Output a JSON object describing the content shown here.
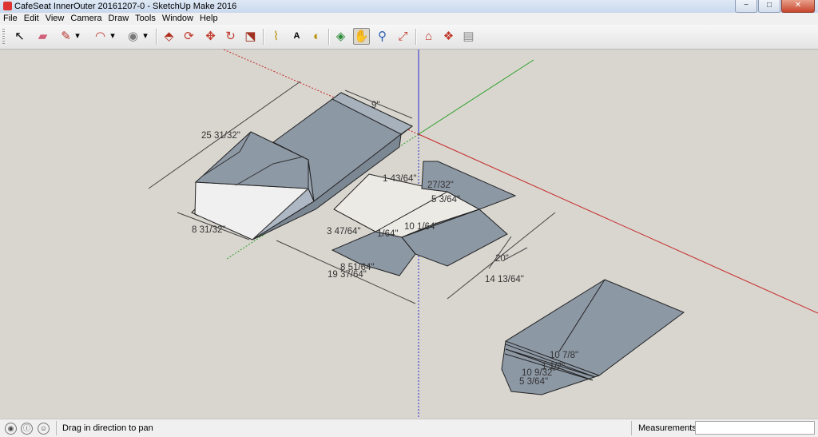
{
  "window": {
    "title": "CafeSeat InnerOuter 20161207-0 - SketchUp Make 2016",
    "controls": {
      "minimize": "−",
      "maximize": "□",
      "close": "✕"
    }
  },
  "menu": [
    "File",
    "Edit",
    "View",
    "Camera",
    "Draw",
    "Tools",
    "Window",
    "Help"
  ],
  "toolbar": {
    "tools": [
      {
        "name": "select-tool",
        "glyph": "↖",
        "active": false
      },
      {
        "name": "eraser-tool",
        "glyph": "▰",
        "active": false
      },
      {
        "name": "pencil-tool",
        "glyph": "✎",
        "active": false
      },
      {
        "name": "pencil-dropdown",
        "glyph": "▾",
        "active": false
      },
      {
        "name": "arc-tool",
        "glyph": "◠",
        "active": false
      },
      {
        "name": "arc-dropdown",
        "glyph": "▾",
        "active": false
      },
      {
        "name": "paint-bucket-tool",
        "glyph": "◉",
        "active": false
      },
      {
        "name": "paint-dropdown",
        "glyph": "▾",
        "active": false
      },
      {
        "name": "push-pull-tool",
        "glyph": "⬘",
        "active": false
      },
      {
        "name": "offset-tool",
        "glyph": "⟳",
        "active": false
      },
      {
        "name": "move-tool",
        "glyph": "✥",
        "active": false
      },
      {
        "name": "rotate-tool",
        "glyph": "↻",
        "active": false
      },
      {
        "name": "scale-tool",
        "glyph": "⬔",
        "active": false
      },
      {
        "name": "tape-measure-tool",
        "glyph": "⌇",
        "active": false
      },
      {
        "name": "text-tool",
        "glyph": "A",
        "active": false
      },
      {
        "name": "protractor-tool",
        "glyph": "◐",
        "active": false
      },
      {
        "name": "orbit-tool",
        "glyph": "◈",
        "active": false
      },
      {
        "name": "pan-tool",
        "glyph": "✋",
        "active": true
      },
      {
        "name": "zoom-tool",
        "glyph": "⚲",
        "active": false
      },
      {
        "name": "zoom-extents-tool",
        "glyph": "⤢",
        "active": false
      },
      {
        "name": "warehouse-tool",
        "glyph": "⌂",
        "active": false
      },
      {
        "name": "components-tool",
        "glyph": "❖",
        "active": false
      },
      {
        "name": "extension-tool",
        "glyph": "▤",
        "active": false
      }
    ]
  },
  "dimensions": {
    "d1": "9\"",
    "d2": "25 31/32\"",
    "d3": "8 31/32\"",
    "d4": "1 43/64\"",
    "d5": "27/32\"",
    "d6": "5 3/64\"",
    "d7": "10 1/64\"",
    "d8": "3 47/64\"",
    "d9": "1/64\"",
    "d10": "8 51/64\"",
    "d11": "19 37/64\"",
    "d12": "20\"",
    "d13": "14 13/64\"",
    "d14": "10 7/8\"",
    "d15": "10 9/32\"",
    "d16": "5 3/64\"",
    "d17": "1 1/2\""
  },
  "status": {
    "hint": "Drag in direction to pan",
    "measurements_label": "Measurements",
    "measurements_value": ""
  }
}
